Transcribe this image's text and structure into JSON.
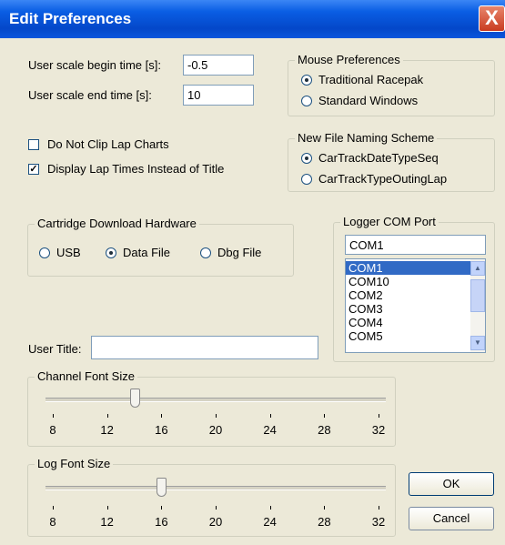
{
  "window": {
    "title": "Edit Preferences",
    "close_glyph": "X"
  },
  "scale": {
    "begin_label": "User scale begin time [s]:",
    "begin_value": "-0.5",
    "end_label": "User scale end time [s]:",
    "end_value": "10"
  },
  "mouse_prefs": {
    "title": "Mouse Preferences",
    "options": [
      {
        "label": "Traditional Racepak",
        "selected": true
      },
      {
        "label": "Standard Windows",
        "selected": false
      }
    ]
  },
  "checkboxes": [
    {
      "label": "Do Not Clip Lap Charts",
      "checked": false
    },
    {
      "label": "Display Lap Times Instead of Title",
      "checked": true
    }
  ],
  "naming": {
    "title": "New File Naming Scheme",
    "options": [
      {
        "label": "CarTrackDateTypeSeq",
        "selected": true
      },
      {
        "label": "CarTrackTypeOutingLap",
        "selected": false
      }
    ]
  },
  "cartridge": {
    "title": "Cartridge Download Hardware",
    "options": [
      {
        "label": "USB",
        "selected": false
      },
      {
        "label": "Data File",
        "selected": true
      },
      {
        "label": "Dbg File",
        "selected": false
      }
    ]
  },
  "com_port": {
    "title": "Logger COM Port",
    "value": "COM1",
    "items": [
      "COM1",
      "COM10",
      "COM2",
      "COM3",
      "COM4",
      "COM5"
    ],
    "selected_index": 0
  },
  "user_title": {
    "label": "User Title:",
    "value": ""
  },
  "channel_font": {
    "title": "Channel Font Size",
    "min": 8,
    "max": 32,
    "value": 14,
    "ticks": [
      "8",
      "12",
      "16",
      "20",
      "24",
      "28",
      "32"
    ]
  },
  "log_font": {
    "title": "Log Font Size",
    "min": 8,
    "max": 32,
    "value": 16,
    "ticks": [
      "8",
      "12",
      "16",
      "20",
      "24",
      "28",
      "32"
    ]
  },
  "buttons": {
    "ok": "OK",
    "cancel": "Cancel"
  }
}
